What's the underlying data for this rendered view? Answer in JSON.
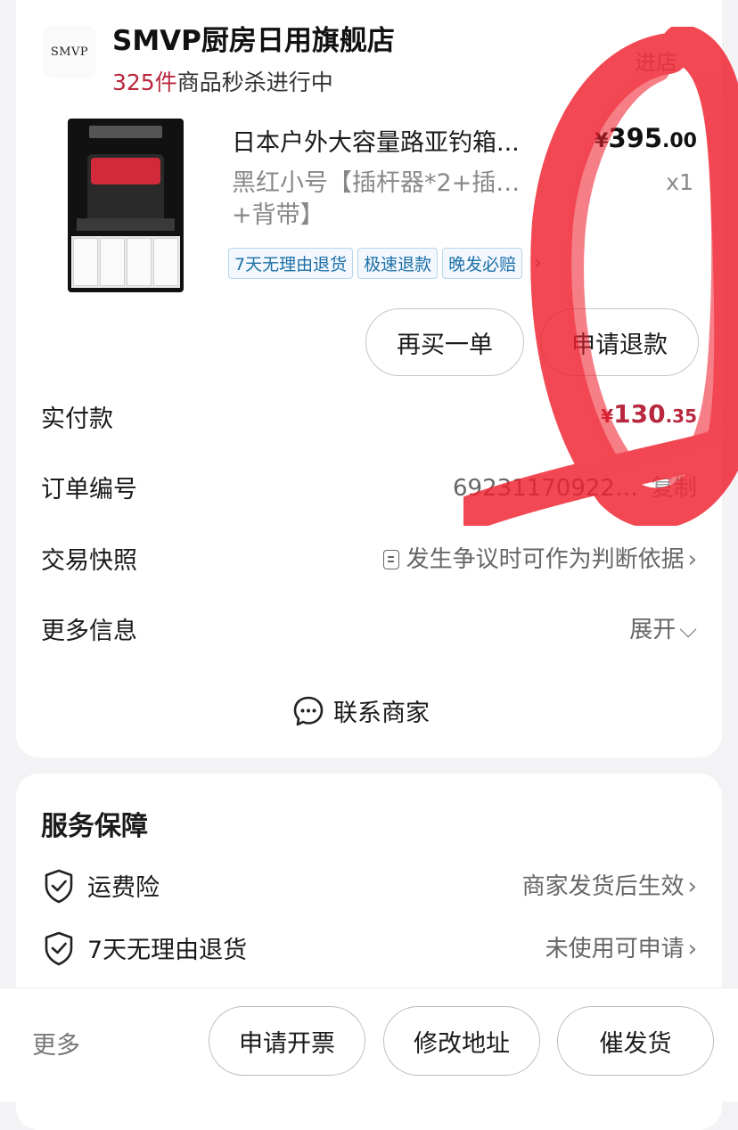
{
  "shop": {
    "logo_text": "SMVP",
    "name": "SMVP厨房日用旗舰店",
    "flash_count": "325件",
    "flash_text": "商品秒杀进行中",
    "top_right_link": "进店"
  },
  "product": {
    "title": "日本户外大容量路亚钓箱...",
    "price_symbol": "¥",
    "price_int": "395",
    "price_dec": ".00",
    "sku": "黑红小号【插杆器*2+插…+背带】",
    "qty": "x1",
    "tags": [
      "7天无理由退货",
      "极速退款",
      "晚发必赔"
    ],
    "tags_more_icon": "chevron-right-icon"
  },
  "actions": {
    "rebuy_label": "再买一单",
    "refund_label": "申请退款"
  },
  "info": {
    "paid_label": "实付款",
    "paid_symbol": "¥",
    "paid_int": "130",
    "paid_dec": ".35",
    "order_label": "订单编号",
    "order_value": "69231170922…",
    "order_copy": "复制",
    "snapshot_label": "交易快照",
    "snapshot_value": "发生争议时可作为判断依据",
    "more_label": "更多信息",
    "more_value": "展开"
  },
  "contact": {
    "label": "联系商家",
    "icon": "chat-bubble-icon"
  },
  "service": {
    "title": "服务保障",
    "items": [
      {
        "name": "运费险",
        "status": "商家发货后生效",
        "icon": "shield-check-icon"
      },
      {
        "name": "7天无理由退货",
        "status": "未使用可申请",
        "icon": "shield-check-icon"
      }
    ]
  },
  "bottom_bar": {
    "more_label": "更多",
    "invoice_label": "申请开票",
    "address_label": "修改地址",
    "urge_label": "催发货"
  },
  "colors": {
    "accent_red": "#b8283e",
    "tag_blue": "#1d6fa8",
    "scribble_red": "#f0202e"
  }
}
